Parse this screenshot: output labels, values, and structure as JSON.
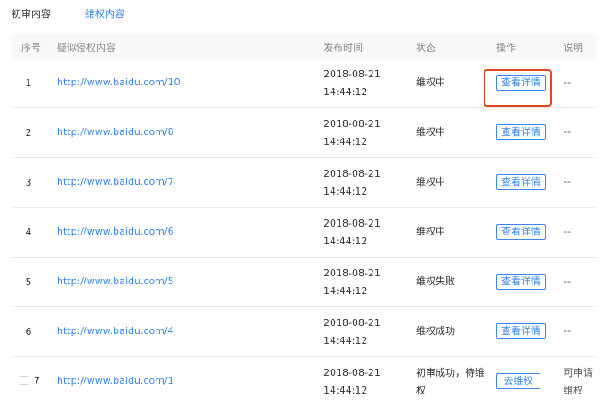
{
  "tabs": [
    "初审内容",
    "维权内容"
  ],
  "headers": {
    "no": "序号",
    "content": "疑似侵权内容",
    "time": "发布时间",
    "status": "状态",
    "action": "操作",
    "note": "说明"
  },
  "rows": [
    {
      "no": "1",
      "url": "http://www.baidu.com/10",
      "date": "2018-08-21",
      "time": "14:44:12",
      "status": "维权中",
      "action": "查看详情",
      "note": "--"
    },
    {
      "no": "2",
      "url": "http://www.baidu.com/8",
      "date": "2018-08-21",
      "time": "14:44:12",
      "status": "维权中",
      "action": "查看详情",
      "note": "--"
    },
    {
      "no": "3",
      "url": "http://www.baidu.com/7",
      "date": "2018-08-21",
      "time": "14:44:12",
      "status": "维权中",
      "action": "查看详情",
      "note": "--"
    },
    {
      "no": "4",
      "url": "http://www.baidu.com/6",
      "date": "2018-08-21",
      "time": "14:44:12",
      "status": "维权中",
      "action": "查看详情",
      "note": "--"
    },
    {
      "no": "5",
      "url": "http://www.baidu.com/5",
      "date": "2018-08-21",
      "time": "14:44:12",
      "status": "维权失败",
      "action": "查看详情",
      "note": "--"
    },
    {
      "no": "6",
      "url": "http://www.baidu.com/4",
      "date": "2018-08-21",
      "time": "14:44:12",
      "status": "维权成功",
      "action": "查看详情",
      "note": "--"
    },
    {
      "no": "7",
      "url": "http://www.baidu.com/1",
      "date": "2018-08-21",
      "time": "14:44:12",
      "status_line1": "初审成功，待维",
      "status_line2": "权",
      "action": "去维权",
      "note_line1": "可申请",
      "note_line2": "维权"
    }
  ]
}
